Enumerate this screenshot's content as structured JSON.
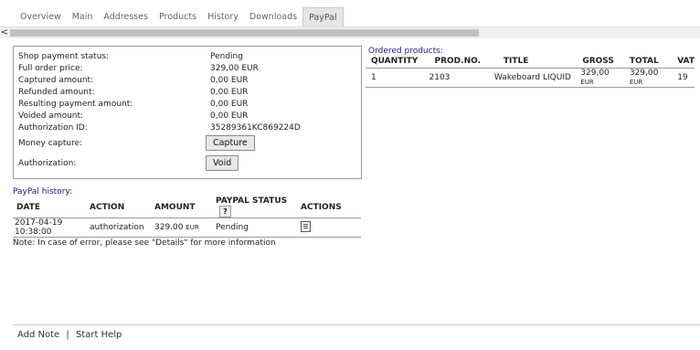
{
  "tabs": [
    "Overview",
    "Main",
    "Addresses",
    "Products",
    "History",
    "Downloads",
    "PayPal"
  ],
  "scrollbar": {
    "left_arrow": "<"
  },
  "payment": {
    "rows": [
      {
        "label": "Shop payment status:",
        "value": "Pending"
      },
      {
        "label": "Full order price:",
        "value": "329,00 EUR"
      },
      {
        "label": "Captured amount:",
        "value": "0,00 EUR"
      },
      {
        "label": "Refunded amount:",
        "value": "0,00 EUR"
      },
      {
        "label": "Resulting payment amount:",
        "value": "0,00 EUR"
      },
      {
        "label": "Voided amount:",
        "value": "0,00 EUR"
      },
      {
        "label": "Authorization ID:",
        "value": "35289361KC869224D"
      }
    ],
    "capture_label": "Money capture:",
    "capture_button": "Capture",
    "auth_label": "Authorization:",
    "void_button": "Void"
  },
  "history": {
    "title": "PayPal history:",
    "columns": [
      "DATE",
      "ACTION",
      "AMOUNT",
      "PAYPAL STATUS",
      "ACTIONS"
    ],
    "help": "?",
    "rows": [
      {
        "date": "2017-04-19 10:38:00",
        "action": "authorization",
        "amount": "329.00",
        "currency": "EUR",
        "status": "Pending"
      }
    ]
  },
  "note": "Note: In case of error, please see \"Details\" for more information",
  "products": {
    "title": "Ordered products:",
    "columns": [
      "QUANTITY",
      "PROD.NO.",
      "TITLE",
      "GROSS",
      "TOTAL",
      "VAT"
    ],
    "rows": [
      {
        "quantity": "1",
        "prodno": "2103",
        "title": "Wakeboard LIQUID",
        "gross": "329,00",
        "total": "329,00",
        "currency": "EUR",
        "vat": "19"
      }
    ]
  },
  "footer": {
    "add_note": "Add Note",
    "sep": "|",
    "start_help": "Start Help"
  }
}
